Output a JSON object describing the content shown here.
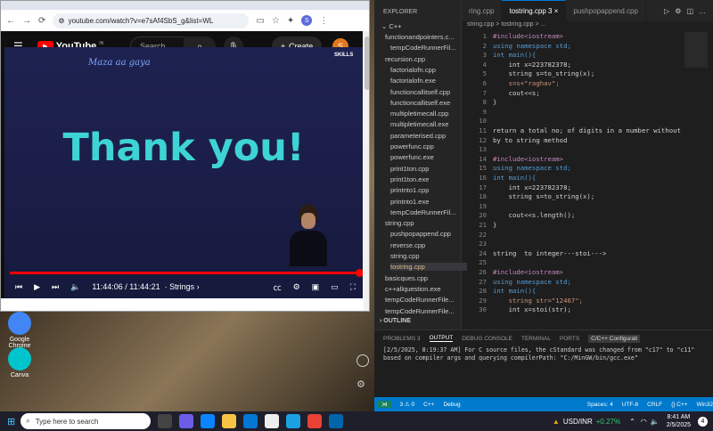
{
  "desktop": {
    "icons": [
      {
        "label": "Google Chrome",
        "color": "#4285f4"
      },
      {
        "label": "Canva",
        "color": "#00c4cc"
      }
    ]
  },
  "browser": {
    "url": "youtube.com/watch?v=e7sAf4SbS_g&list=WL",
    "profile_initial": "S"
  },
  "youtube": {
    "brand": "YouTube",
    "region": "IN",
    "search_placeholder": "Search",
    "create_label": "Create",
    "avatar_initial": "S",
    "video": {
      "handwritten": "Maza aa gaya",
      "main_text": "Thank you!",
      "watermark": "SKILLS",
      "time": "11:44:06 / 11:44:21",
      "chapter": "Strings",
      "progress": 0.99
    }
  },
  "vscode": {
    "explorer_title": "EXPLORER",
    "section": "C++",
    "files": [
      "functionandpointers.c...",
      "tempCodeRunnerFil...",
      "recursion.cpp",
      "factorialofn.cpp",
      "factorialofn.exe",
      "functioncallitself.cpp",
      "functioncallitself.exe",
      "multipletimecall.cpp",
      "multipletimecall.exe",
      "parameterised.cpp",
      "powerfunc.cpp",
      "powerfunc.exe",
      "print1ton.cpp",
      "print1ton.exe",
      "printnto1.cpp",
      "printnto1.exe",
      "tempCodeRunnerFil...",
      "string.cpp",
      "pushpopappend.cpp",
      "reverse.cpp",
      "string.cpp",
      "tostring.cpp",
      "basicques.cpp",
      "c++allquestion.exe",
      "tempCodeRunnerFile...",
      "tempCodeRunnerFile..."
    ],
    "outline_label": "OUTLINE",
    "tabs": [
      "ring.cpp",
      "tostring.cpp 3",
      "pushpopappend.cpp"
    ],
    "breadcrumb": "string.cpp > tostring.cpp > ...",
    "code_lines": [
      {
        "n": "1",
        "t": "#include<iostream>"
      },
      {
        "n": "2",
        "t": "using namespace std;"
      },
      {
        "n": "3",
        "t": "int main(){"
      },
      {
        "n": "4",
        "t": "    int x=223782378;"
      },
      {
        "n": "5",
        "t": "    string s=to_string(x);"
      },
      {
        "n": "6",
        "t": "    s=s+\"raghav\";"
      },
      {
        "n": "7",
        "t": "    cout<<s;"
      },
      {
        "n": "8",
        "t": "}"
      },
      {
        "n": "9",
        "t": ""
      },
      {
        "n": "10",
        "t": ""
      },
      {
        "n": "11",
        "t": "return a total no; of digits in a number without"
      },
      {
        "n": "12",
        "t": "by to string method"
      },
      {
        "n": "13",
        "t": ""
      },
      {
        "n": "14",
        "t": "#include<iostream>"
      },
      {
        "n": "15",
        "t": "using namespace std;"
      },
      {
        "n": "16",
        "t": "int main(){"
      },
      {
        "n": "17",
        "t": "    int x=223782378;"
      },
      {
        "n": "18",
        "t": "    string s=to_string(x);"
      },
      {
        "n": "19",
        "t": ""
      },
      {
        "n": "20",
        "t": "    cout<<s.length();"
      },
      {
        "n": "21",
        "t": "}"
      },
      {
        "n": "22",
        "t": ""
      },
      {
        "n": "23",
        "t": ""
      },
      {
        "n": "24",
        "t": "string  to integer---stoi--->"
      },
      {
        "n": "25",
        "t": ""
      },
      {
        "n": "26",
        "t": "#include<iostream>"
      },
      {
        "n": "27",
        "t": "using namespace std;"
      },
      {
        "n": "28",
        "t": "int main(){"
      },
      {
        "n": "29",
        "t": "    string str=\"12467\";"
      },
      {
        "n": "30",
        "t": "    int x=stoi(str);"
      }
    ],
    "panel_tabs": [
      "PROBLEMS 3",
      "OUTPUT",
      "DEBUG CONSOLE",
      "TERMINAL",
      "PORTS",
      "C/C++ Configurati"
    ],
    "output": "[2/5/2025, 8:19:37 AM] For C source files, the cStandard was changed from \"c17\" to \"c11\" based on compiler args and querying compilerPath: \"C:/MinGW/bin/gcc.exe\"",
    "status": [
      "3 ⚠ 0",
      "C++",
      "Debug",
      "Spaces: 4",
      "UTF-8",
      "CRLF",
      "{} C++",
      "Win32"
    ]
  },
  "taskbar": {
    "search_placeholder": "Type here to search",
    "ticker": "USD/INR",
    "ticker_change": "+0.27%",
    "time": "8:41 AM",
    "date": "2/5/2025",
    "badge": "4"
  }
}
